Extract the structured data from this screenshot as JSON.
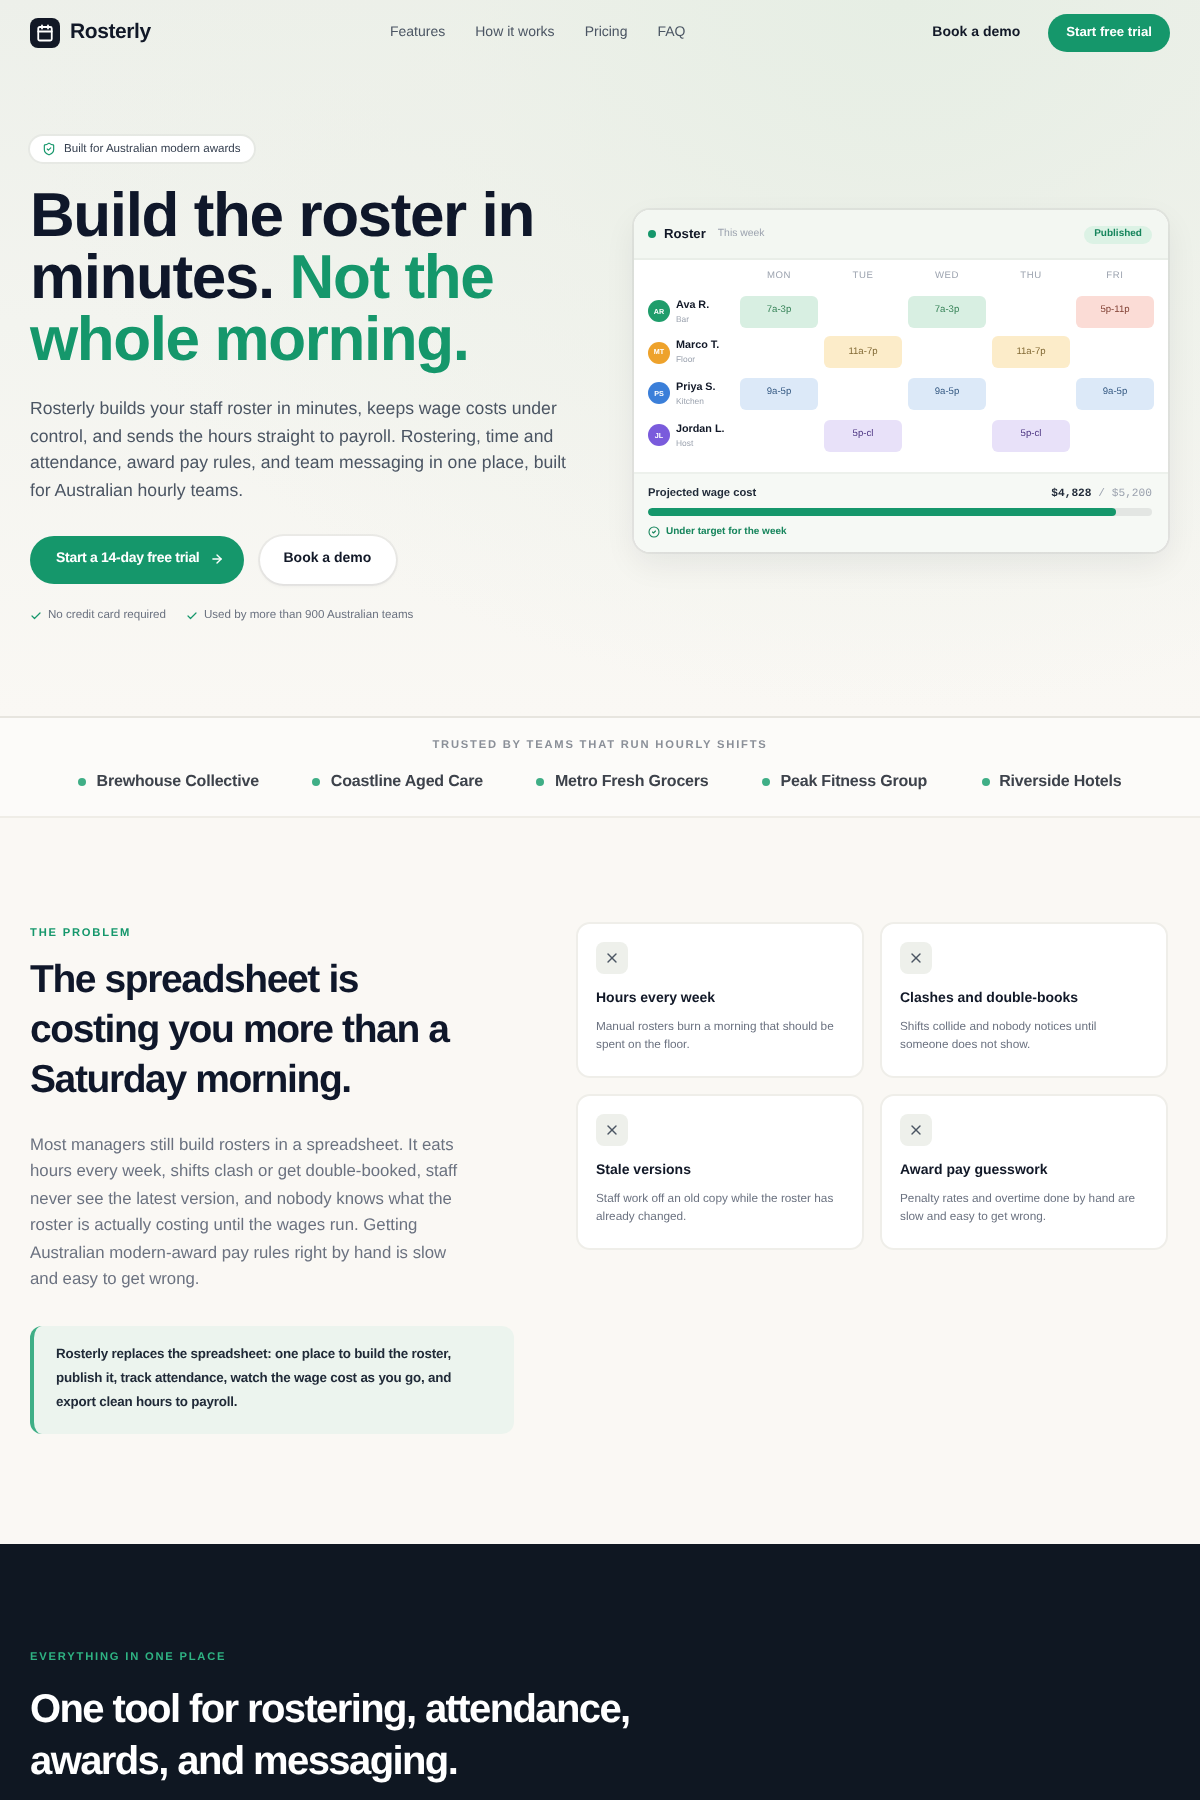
{
  "header": {
    "brand": "Rosterly",
    "nav": [
      "Features",
      "How it works",
      "Pricing",
      "FAQ"
    ],
    "demo_link": "Book a demo",
    "cta": "Start free trial"
  },
  "hero": {
    "badge": "Built for Australian modern awards",
    "title": "Build the roster in minutes.",
    "title_accent": "Not the whole morning.",
    "text": "Rosterly builds your staff roster in minutes, keeps wage costs under control, and sends the hours straight to payroll. Rostering, time and attendance, award pay rules, and team messaging in one place, built for Australian hourly teams.",
    "primary_button": "Start a 14-day free trial",
    "secondary_button": "Book a demo",
    "assurances": [
      "No credit card required",
      "Used by more than 900 Australian teams"
    ]
  },
  "roster": {
    "title": "Roster",
    "subtitle": "This week",
    "status": "Published",
    "days": [
      "MON",
      "TUE",
      "WED",
      "THU",
      "FRI"
    ],
    "staff": [
      {
        "initials": "AR",
        "name": "Ava R.",
        "role": "Bar",
        "color": "#1f9d6b",
        "shifts": [
          {
            "kind": "shift",
            "time": "7a-3p",
            "color": "#d8efe2"
          },
          {
            "kind": "off"
          },
          {
            "kind": "shift",
            "time": "7a-3p",
            "color": "#d8efe2"
          },
          {
            "kind": "off"
          },
          {
            "kind": "shift",
            "time": "5p-11p",
            "color": "#fbdcd6"
          }
        ]
      },
      {
        "initials": "MT",
        "name": "Marco T.",
        "role": "Floor",
        "color": "#eea22b",
        "shifts": [
          {
            "kind": "off"
          },
          {
            "kind": "shift",
            "time": "11a-7p",
            "color": "#fcecc9"
          },
          {
            "kind": "off"
          },
          {
            "kind": "shift",
            "time": "11a-7p",
            "color": "#fcecc9"
          },
          {
            "kind": "off"
          }
        ]
      },
      {
        "initials": "PS",
        "name": "Priya S.",
        "role": "Kitchen",
        "color": "#3b7fd9",
        "shifts": [
          {
            "kind": "shift",
            "time": "9a-5p",
            "color": "#dce9f8"
          },
          {
            "kind": "off"
          },
          {
            "kind": "shift",
            "time": "9a-5p",
            "color": "#dce9f8"
          },
          {
            "kind": "off"
          },
          {
            "kind": "shift",
            "time": "9a-5p",
            "color": "#dce9f8"
          }
        ]
      },
      {
        "initials": "JL",
        "name": "Jordan L.",
        "role": "Host",
        "color": "#7a5bdc",
        "shifts": [
          {
            "kind": "off"
          },
          {
            "kind": "shift",
            "time": "5p-cl",
            "color": "#e8e1f9"
          },
          {
            "kind": "off"
          },
          {
            "kind": "shift",
            "time": "5p-cl",
            "color": "#e8e1f9"
          },
          {
            "kind": "off"
          }
        ]
      }
    ],
    "wage": {
      "label": "Projected wage cost",
      "amount": "**$4,828** / $5,200",
      "level": 0.93,
      "status": "Under target for the week"
    }
  },
  "trusted": {
    "eyebrow": "TRUSTED BY TEAMS THAT RUN HOURLY SHIFTS",
    "logos": [
      "Brewhouse Collective",
      "Coastline Aged Care",
      "Metro Fresh Grocers",
      "Peak Fitness Group",
      "Riverside Hotels"
    ]
  },
  "problem": {
    "eyebrow": "THE PROBLEM",
    "title": "The spreadsheet is costing you more than a Saturday morning.",
    "text": "Most managers still build rosters in a spreadsheet. It eats hours every week, shifts clash or get double-booked, staff never see the latest version, and nobody knows what the roster is actually costing until the wages run. Getting Australian modern-award pay rules right by hand is slow and easy to get wrong.",
    "callout": "Rosterly replaces the spreadsheet: one place to build the roster, publish it, track attendance, watch the wage cost as you go, and export clean hours to payroll.",
    "cards": [
      {
        "title": "Hours every week",
        "text": "Manual rosters burn a morning that should be spent on the floor."
      },
      {
        "title": "Clashes and double-books",
        "text": "Shifts collide and nobody notices until someone does not show."
      },
      {
        "title": "Stale versions",
        "text": "Staff work off an old copy while the roster has already changed."
      },
      {
        "title": "Award pay guesswork",
        "text": "Penalty rates and overtime done by hand are slow and easy to get wrong."
      }
    ]
  },
  "features": {
    "eyebrow": "EVERYTHING IN ONE PLACE",
    "title": "One tool for rostering, attendance, awards, and messaging."
  }
}
